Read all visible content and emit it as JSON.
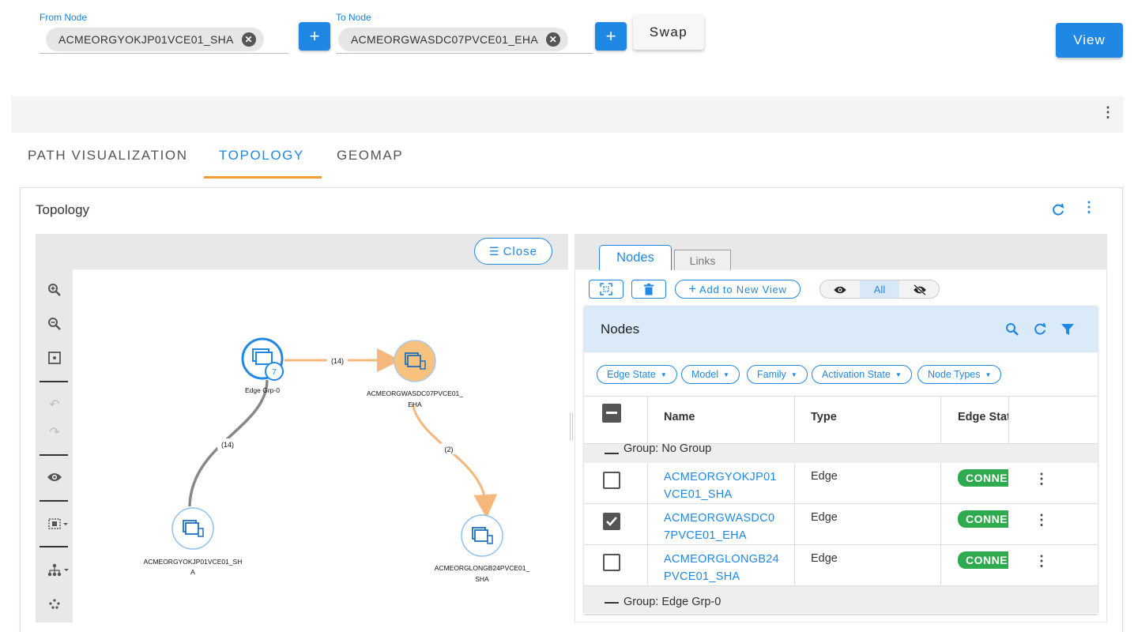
{
  "selector": {
    "from_label": "From Node",
    "from_value": "ACMEORGYOKJP01VCE01_SHA",
    "to_label": "To Node",
    "to_value": "ACMEORGWASDC07PVCE01_EHA",
    "add_symbol": "+",
    "swap_label": "Swap",
    "view_label": "View"
  },
  "tabs": [
    {
      "label": "PATH VISUALIZATION",
      "active": false
    },
    {
      "label": "TOPOLOGY",
      "active": true
    },
    {
      "label": "GEOMAP",
      "active": false
    }
  ],
  "topology": {
    "title": "Topology",
    "close_label": "Close",
    "graph": {
      "group_node": {
        "label": "Edge Grp-0",
        "count": "7"
      },
      "nodes": [
        {
          "label_line1": "ACMEORGWASDC07PVCE01_",
          "label_line2": "EHA",
          "highlighted": true
        },
        {
          "label_line1": "ACMEORGYOKJP01VCE01_SH",
          "label_line2": "A",
          "highlighted": false
        },
        {
          "label_line1": "ACMEORGLONGB24PVCE01_",
          "label_line2": "SHA",
          "highlighted": false
        }
      ],
      "edges": [
        {
          "label": "(14)",
          "color": "#f5b87a"
        },
        {
          "label": "(14)",
          "color": "#888888"
        },
        {
          "label": "(2)",
          "color": "#f5b87a"
        }
      ]
    }
  },
  "nodes_panel": {
    "tabs": [
      {
        "label": "Nodes",
        "active": true
      },
      {
        "label": "Links",
        "active": false
      }
    ],
    "add_view_label": "Add to New View",
    "visibility_all_label": "All",
    "title": "Nodes",
    "filters": [
      {
        "label": "Edge State"
      },
      {
        "label": "Model"
      },
      {
        "label": "Family"
      },
      {
        "label": "Activation State"
      },
      {
        "label": "Node Types"
      }
    ],
    "columns": {
      "name": "Name",
      "type": "Type",
      "edge_state": "Edge Stat"
    },
    "group_no_group": "Group: No Group",
    "group_edge": "Group: Edge Grp-0",
    "rows": [
      {
        "name_line1": "ACMEORGYOKJP01",
        "name_line2": "VCE01_SHA",
        "type": "Edge",
        "state": "CONNE",
        "checked": false
      },
      {
        "name_line1": "ACMEORGWASDC0",
        "name_line2": "7PVCE01_EHA",
        "type": "Edge",
        "state": "CONNE",
        "checked": true
      },
      {
        "name_line1": "ACMEORGLONGB24",
        "name_line2": "PVCE01_SHA",
        "type": "Edge",
        "state": "CONNE",
        "checked": false
      }
    ]
  },
  "colors": {
    "accent": "#1f88e5",
    "connected": "#2eaa4f",
    "highlight_node": "#f7c27e"
  }
}
